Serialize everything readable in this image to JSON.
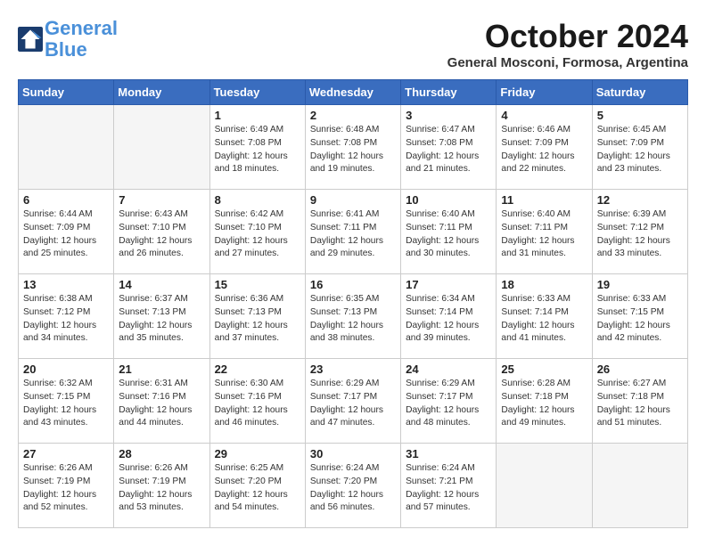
{
  "header": {
    "logo_line1": "General",
    "logo_line2": "Blue",
    "month": "October 2024",
    "location": "General Mosconi, Formosa, Argentina"
  },
  "days_of_week": [
    "Sunday",
    "Monday",
    "Tuesday",
    "Wednesday",
    "Thursday",
    "Friday",
    "Saturday"
  ],
  "weeks": [
    [
      {
        "day": "",
        "empty": true
      },
      {
        "day": "",
        "empty": true
      },
      {
        "day": "1",
        "sunrise": "Sunrise: 6:49 AM",
        "sunset": "Sunset: 7:08 PM",
        "daylight": "Daylight: 12 hours and 18 minutes."
      },
      {
        "day": "2",
        "sunrise": "Sunrise: 6:48 AM",
        "sunset": "Sunset: 7:08 PM",
        "daylight": "Daylight: 12 hours and 19 minutes."
      },
      {
        "day": "3",
        "sunrise": "Sunrise: 6:47 AM",
        "sunset": "Sunset: 7:08 PM",
        "daylight": "Daylight: 12 hours and 21 minutes."
      },
      {
        "day": "4",
        "sunrise": "Sunrise: 6:46 AM",
        "sunset": "Sunset: 7:09 PM",
        "daylight": "Daylight: 12 hours and 22 minutes."
      },
      {
        "day": "5",
        "sunrise": "Sunrise: 6:45 AM",
        "sunset": "Sunset: 7:09 PM",
        "daylight": "Daylight: 12 hours and 23 minutes."
      }
    ],
    [
      {
        "day": "6",
        "sunrise": "Sunrise: 6:44 AM",
        "sunset": "Sunset: 7:09 PM",
        "daylight": "Daylight: 12 hours and 25 minutes."
      },
      {
        "day": "7",
        "sunrise": "Sunrise: 6:43 AM",
        "sunset": "Sunset: 7:10 PM",
        "daylight": "Daylight: 12 hours and 26 minutes."
      },
      {
        "day": "8",
        "sunrise": "Sunrise: 6:42 AM",
        "sunset": "Sunset: 7:10 PM",
        "daylight": "Daylight: 12 hours and 27 minutes."
      },
      {
        "day": "9",
        "sunrise": "Sunrise: 6:41 AM",
        "sunset": "Sunset: 7:11 PM",
        "daylight": "Daylight: 12 hours and 29 minutes."
      },
      {
        "day": "10",
        "sunrise": "Sunrise: 6:40 AM",
        "sunset": "Sunset: 7:11 PM",
        "daylight": "Daylight: 12 hours and 30 minutes."
      },
      {
        "day": "11",
        "sunrise": "Sunrise: 6:40 AM",
        "sunset": "Sunset: 7:11 PM",
        "daylight": "Daylight: 12 hours and 31 minutes."
      },
      {
        "day": "12",
        "sunrise": "Sunrise: 6:39 AM",
        "sunset": "Sunset: 7:12 PM",
        "daylight": "Daylight: 12 hours and 33 minutes."
      }
    ],
    [
      {
        "day": "13",
        "sunrise": "Sunrise: 6:38 AM",
        "sunset": "Sunset: 7:12 PM",
        "daylight": "Daylight: 12 hours and 34 minutes."
      },
      {
        "day": "14",
        "sunrise": "Sunrise: 6:37 AM",
        "sunset": "Sunset: 7:13 PM",
        "daylight": "Daylight: 12 hours and 35 minutes."
      },
      {
        "day": "15",
        "sunrise": "Sunrise: 6:36 AM",
        "sunset": "Sunset: 7:13 PM",
        "daylight": "Daylight: 12 hours and 37 minutes."
      },
      {
        "day": "16",
        "sunrise": "Sunrise: 6:35 AM",
        "sunset": "Sunset: 7:13 PM",
        "daylight": "Daylight: 12 hours and 38 minutes."
      },
      {
        "day": "17",
        "sunrise": "Sunrise: 6:34 AM",
        "sunset": "Sunset: 7:14 PM",
        "daylight": "Daylight: 12 hours and 39 minutes."
      },
      {
        "day": "18",
        "sunrise": "Sunrise: 6:33 AM",
        "sunset": "Sunset: 7:14 PM",
        "daylight": "Daylight: 12 hours and 41 minutes."
      },
      {
        "day": "19",
        "sunrise": "Sunrise: 6:33 AM",
        "sunset": "Sunset: 7:15 PM",
        "daylight": "Daylight: 12 hours and 42 minutes."
      }
    ],
    [
      {
        "day": "20",
        "sunrise": "Sunrise: 6:32 AM",
        "sunset": "Sunset: 7:15 PM",
        "daylight": "Daylight: 12 hours and 43 minutes."
      },
      {
        "day": "21",
        "sunrise": "Sunrise: 6:31 AM",
        "sunset": "Sunset: 7:16 PM",
        "daylight": "Daylight: 12 hours and 44 minutes."
      },
      {
        "day": "22",
        "sunrise": "Sunrise: 6:30 AM",
        "sunset": "Sunset: 7:16 PM",
        "daylight": "Daylight: 12 hours and 46 minutes."
      },
      {
        "day": "23",
        "sunrise": "Sunrise: 6:29 AM",
        "sunset": "Sunset: 7:17 PM",
        "daylight": "Daylight: 12 hours and 47 minutes."
      },
      {
        "day": "24",
        "sunrise": "Sunrise: 6:29 AM",
        "sunset": "Sunset: 7:17 PM",
        "daylight": "Daylight: 12 hours and 48 minutes."
      },
      {
        "day": "25",
        "sunrise": "Sunrise: 6:28 AM",
        "sunset": "Sunset: 7:18 PM",
        "daylight": "Daylight: 12 hours and 49 minutes."
      },
      {
        "day": "26",
        "sunrise": "Sunrise: 6:27 AM",
        "sunset": "Sunset: 7:18 PM",
        "daylight": "Daylight: 12 hours and 51 minutes."
      }
    ],
    [
      {
        "day": "27",
        "sunrise": "Sunrise: 6:26 AM",
        "sunset": "Sunset: 7:19 PM",
        "daylight": "Daylight: 12 hours and 52 minutes."
      },
      {
        "day": "28",
        "sunrise": "Sunrise: 6:26 AM",
        "sunset": "Sunset: 7:19 PM",
        "daylight": "Daylight: 12 hours and 53 minutes."
      },
      {
        "day": "29",
        "sunrise": "Sunrise: 6:25 AM",
        "sunset": "Sunset: 7:20 PM",
        "daylight": "Daylight: 12 hours and 54 minutes."
      },
      {
        "day": "30",
        "sunrise": "Sunrise: 6:24 AM",
        "sunset": "Sunset: 7:20 PM",
        "daylight": "Daylight: 12 hours and 56 minutes."
      },
      {
        "day": "31",
        "sunrise": "Sunrise: 6:24 AM",
        "sunset": "Sunset: 7:21 PM",
        "daylight": "Daylight: 12 hours and 57 minutes."
      },
      {
        "day": "",
        "empty": true
      },
      {
        "day": "",
        "empty": true
      }
    ]
  ]
}
